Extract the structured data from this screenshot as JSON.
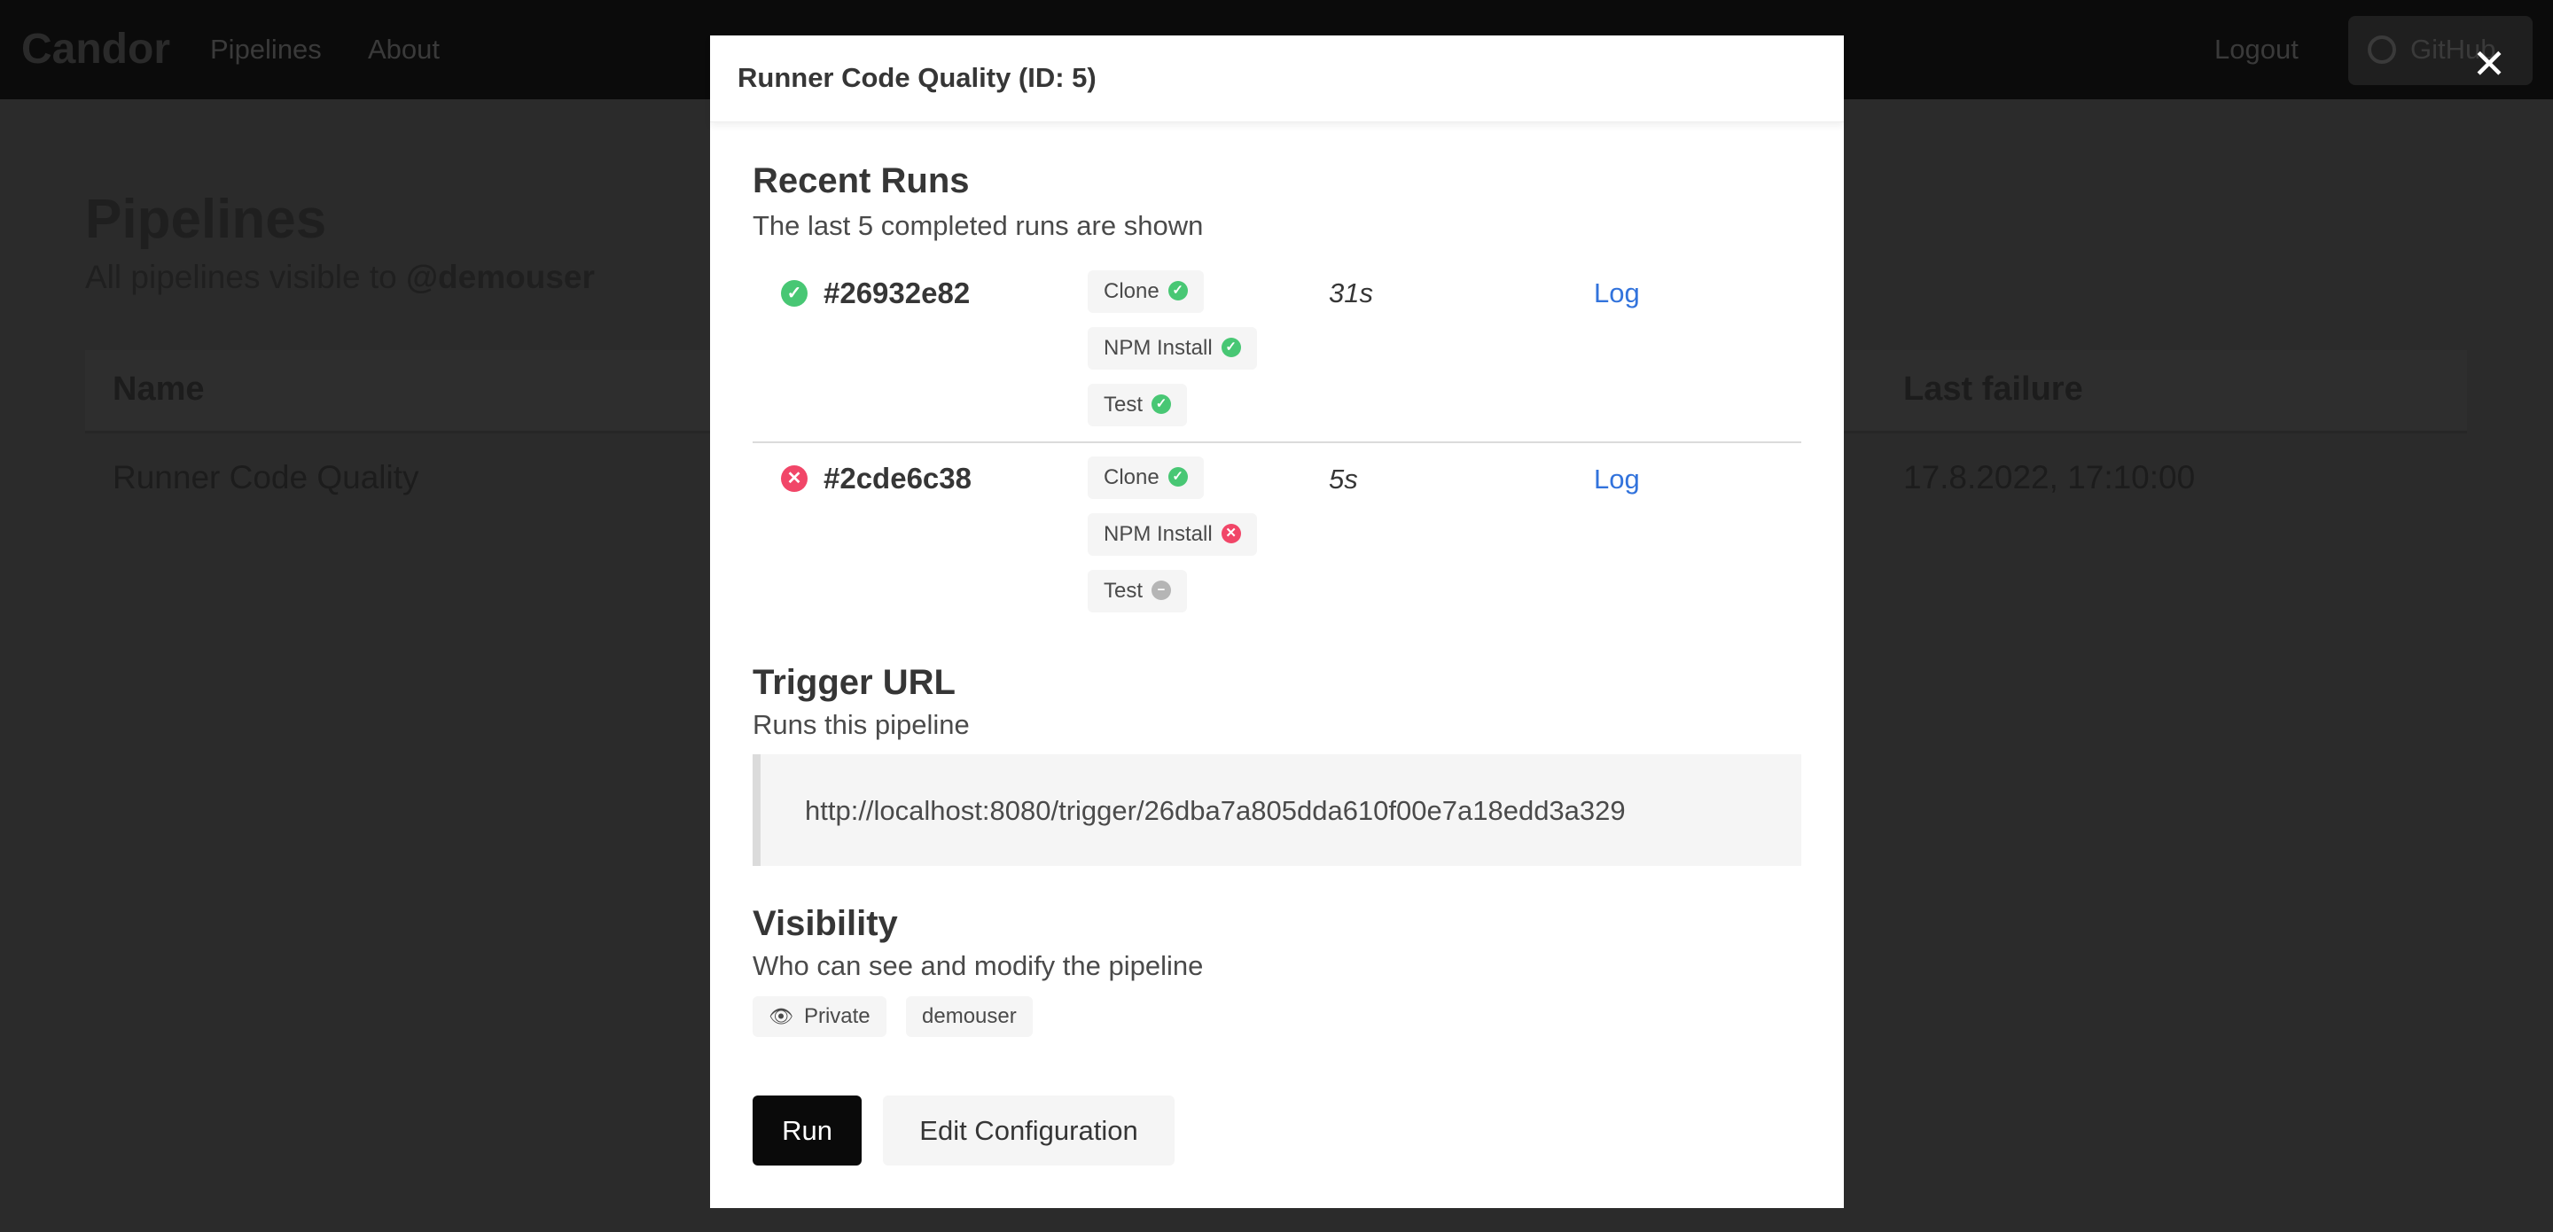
{
  "navbar": {
    "brand": "Candor",
    "links": [
      "Pipelines",
      "About"
    ],
    "logout": "Logout",
    "github": "GitHub"
  },
  "background": {
    "title": "Pipelines",
    "subtitle_prefix": "All pipelines visible to ",
    "subtitle_user": "@demouser",
    "table": {
      "headers": {
        "name": "Name",
        "last_failure": "Last failure"
      },
      "rows": [
        {
          "name": "Runner Code Quality",
          "last_failure": "17.8.2022, 17:10:00"
        }
      ]
    }
  },
  "modal": {
    "title": "Runner Code Quality (ID: 5)",
    "recent_runs": {
      "heading": "Recent Runs",
      "subtitle": "The last 5 completed runs are shown",
      "runs": [
        {
          "status": "success",
          "hash": "#26932e82",
          "duration": "31s",
          "log": "Log",
          "steps": [
            {
              "name": "Clone",
              "status": "success"
            },
            {
              "name": "NPM Install",
              "status": "success"
            },
            {
              "name": "Test",
              "status": "success"
            }
          ]
        },
        {
          "status": "failed",
          "hash": "#2cde6c38",
          "duration": "5s",
          "log": "Log",
          "steps": [
            {
              "name": "Clone",
              "status": "success"
            },
            {
              "name": "NPM Install",
              "status": "failed"
            },
            {
              "name": "Test",
              "status": "skipped"
            }
          ]
        }
      ]
    },
    "trigger": {
      "heading": "Trigger URL",
      "subtitle": "Runs this pipeline",
      "url": "http://localhost:8080/trigger/26dba7a805dda610f00e7a18edd3a329"
    },
    "visibility": {
      "heading": "Visibility",
      "subtitle": "Who can see and modify the pipeline",
      "mode": "Private",
      "user": "demouser"
    },
    "buttons": {
      "run": "Run",
      "edit": "Edit Configuration"
    }
  },
  "colors": {
    "success": "#48c774",
    "danger": "#f14668",
    "skipped": "#b5b5b5",
    "link": "#3273dc"
  }
}
